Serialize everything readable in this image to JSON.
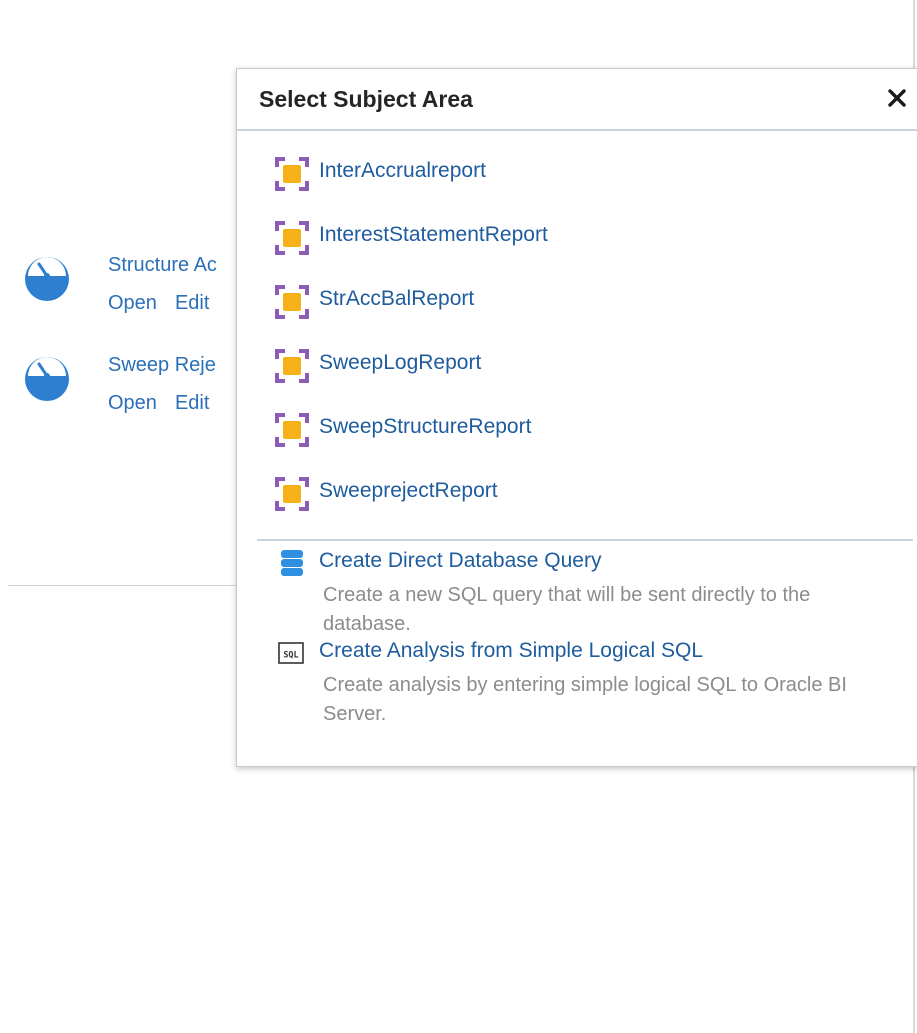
{
  "background": {
    "recent_items": [
      {
        "title": "Structure Ac",
        "open_label": "Open",
        "edit_label": "Edit",
        "icon": "dashboard-gauge-icon"
      },
      {
        "title": "Sweep Reje",
        "open_label": "Open",
        "edit_label": "Edit",
        "icon": "dashboard-gauge-icon"
      }
    ]
  },
  "dialog": {
    "title": "Select Subject Area",
    "close_icon": "close-icon",
    "subject_areas": [
      {
        "label": "InterAccrualreport",
        "icon": "subject-area-icon"
      },
      {
        "label": "InterestStatementReport",
        "icon": "subject-area-icon"
      },
      {
        "label": "StrAccBalReport",
        "icon": "subject-area-icon"
      },
      {
        "label": "SweepLogReport",
        "icon": "subject-area-icon"
      },
      {
        "label": "SweepStructureReport",
        "icon": "subject-area-icon"
      },
      {
        "label": "SweeprejectReport",
        "icon": "subject-area-icon"
      }
    ],
    "actions": [
      {
        "title": "Create Direct Database Query",
        "description": "Create a new SQL query that will be sent directly to the database.",
        "icon": "database-icon"
      },
      {
        "title": "Create Analysis from Simple Logical SQL",
        "description": "Create analysis by entering simple logical SQL to Oracle BI Server.",
        "icon": "sql-icon"
      }
    ]
  },
  "colors": {
    "link": "#1f5c9e",
    "secondary_text": "#8c8c8c",
    "icon_blue": "#2f7fd0",
    "subject_icon_purple": "#8c5bb5",
    "subject_icon_yellow": "#f7b21a"
  }
}
